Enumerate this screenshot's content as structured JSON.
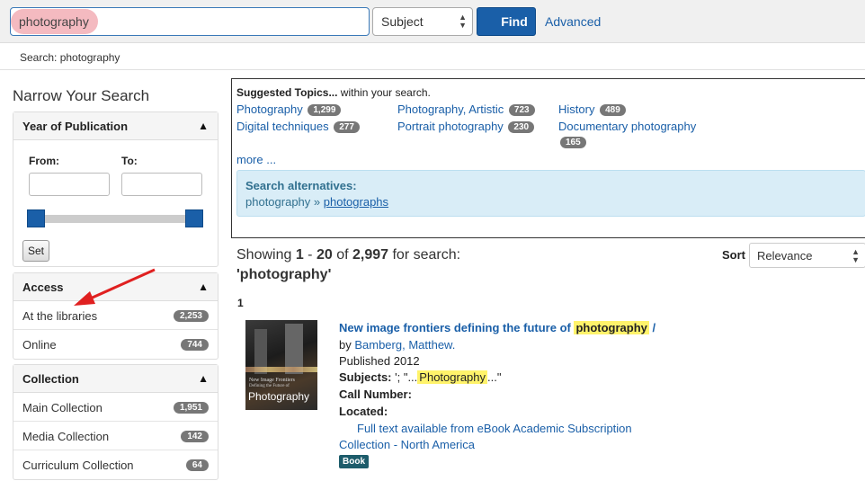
{
  "search": {
    "query": "photography",
    "type_selected": "Subject",
    "find_label": "Find",
    "advanced_label": "Advanced"
  },
  "breadcrumb": "Search: photography",
  "sidebar": {
    "title": "Narrow Your Search",
    "year": {
      "title": "Year of Publication",
      "from_label": "From:",
      "to_label": "To:",
      "set_label": "Set"
    },
    "access": {
      "title": "Access",
      "items": [
        {
          "label": "At the libraries",
          "count": "2,253"
        },
        {
          "label": "Online",
          "count": "744"
        }
      ]
    },
    "collection": {
      "title": "Collection",
      "items": [
        {
          "label": "Main Collection",
          "count": "1,951"
        },
        {
          "label": "Media Collection",
          "count": "142"
        },
        {
          "label": "Curriculum Collection",
          "count": "64"
        }
      ]
    }
  },
  "topics": {
    "heading_bold": "Suggested Topics...",
    "heading_rest": " within your search.",
    "items": [
      {
        "label": "Photography",
        "count": "1,299"
      },
      {
        "label": "Photography, Artistic",
        "count": "723"
      },
      {
        "label": "History",
        "count": "489"
      },
      {
        "label": "Digital techniques",
        "count": "277"
      },
      {
        "label": "Portrait photography",
        "count": "230"
      },
      {
        "label": "Documentary photography",
        "count": "165"
      }
    ],
    "more_label": "more ...",
    "alternatives": {
      "heading": "Search alternatives:",
      "from": "photography",
      "sep": " » ",
      "to": "photographs"
    }
  },
  "results": {
    "showing_prefix": "Showing ",
    "range_start": "1",
    "range_sep": " - ",
    "range_end": "20",
    "of_text": " of ",
    "total": "2,997",
    "for_text": " for search:",
    "query_quoted": "'photography'",
    "sort_label": "Sort",
    "sort_selected": "Relevance",
    "page": "1"
  },
  "record": {
    "title_prefix": "New image frontiers defining the future of ",
    "title_highlight": "photography",
    "title_suffix": " /",
    "by_label": "by ",
    "author": "Bamberg, Matthew.",
    "published": "Published 2012",
    "subjects_label": "Subjects:",
    "subjects_pre": " '; \"...",
    "subjects_highlight": "Photography",
    "subjects_post": "...\"",
    "call_label": "Call Number:",
    "located_label": "Located:",
    "fulltext_link": "Full text available from eBook Academic Subscription",
    "collection_link": "Collection - North America",
    "format_badge": "Book",
    "cover_line1": "New Image Frontiers",
    "cover_line2": "Defining the Future of",
    "cover_line3": "Photography"
  }
}
